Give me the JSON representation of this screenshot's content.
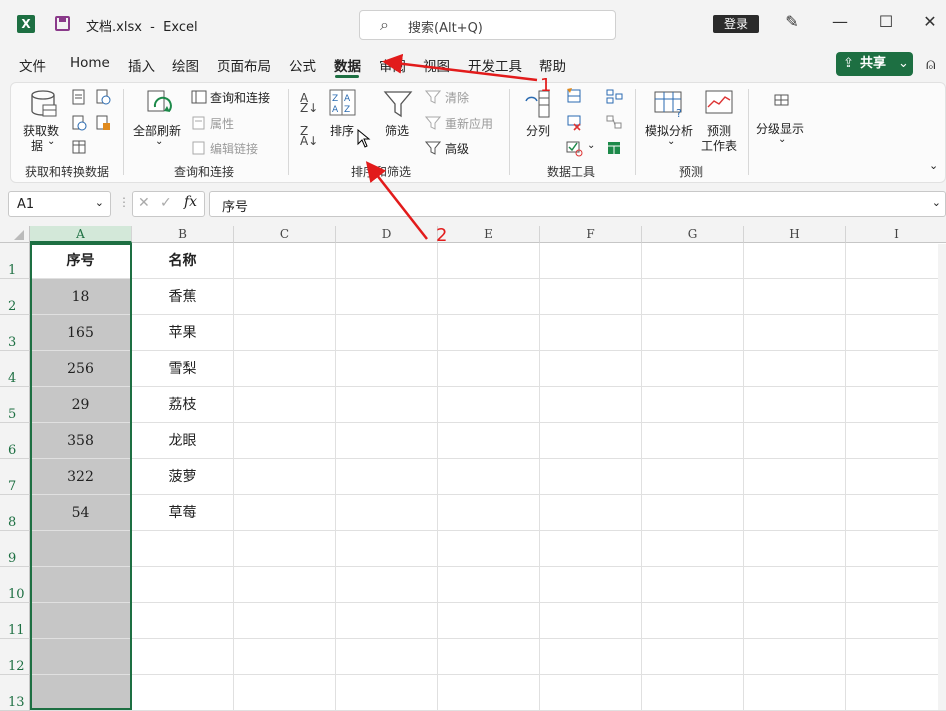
{
  "titlebar": {
    "filename": "文档.xlsx",
    "separator": "-",
    "app": "Excel",
    "search_placeholder": "搜索(Alt+Q)",
    "login": "登录"
  },
  "menu": {
    "tabs": [
      "文件",
      "Home",
      "插入",
      "绘图",
      "页面布局",
      "公式",
      "数据",
      "审阅",
      "视图",
      "开发工具",
      "帮助"
    ],
    "active": "数据",
    "share": "共享"
  },
  "ribbon": {
    "get_data": {
      "label_line1": "获取数",
      "label_line2": "据",
      "group": "获取和转换数据"
    },
    "queries": {
      "refresh_all": "全部刷新",
      "queries_connections": "查询和连接",
      "properties": "属性",
      "edit_links": "编辑链接",
      "group": "查询和连接"
    },
    "sort_filter": {
      "sort": "排序",
      "filter": "筛选",
      "clear": "清除",
      "reapply": "重新应用",
      "advanced": "高级",
      "group": "排序和筛选"
    },
    "data_tools": {
      "text_to_columns": "分列",
      "group": "数据工具"
    },
    "forecast": {
      "what_if": "模拟分析",
      "forecast_sheet_1": "预测",
      "forecast_sheet_2": "工作表",
      "group": "预测"
    },
    "outline": {
      "label": "分级显示"
    }
  },
  "formula_bar": {
    "name_box": "A1",
    "fx": "fx",
    "content": "序号"
  },
  "sheet": {
    "columns": [
      "A",
      "B",
      "C",
      "D",
      "E",
      "F",
      "G",
      "H",
      "I"
    ],
    "rows": [
      "1",
      "2",
      "3",
      "4",
      "5",
      "6",
      "7",
      "8",
      "9",
      "10",
      "11",
      "12",
      "13"
    ],
    "data": [
      [
        "序号",
        "名称"
      ],
      [
        "18",
        "香蕉"
      ],
      [
        "165",
        "苹果"
      ],
      [
        "256",
        "雪梨"
      ],
      [
        "29",
        "荔枝"
      ],
      [
        "358",
        "龙眼"
      ],
      [
        "322",
        "菠萝"
      ],
      [
        "54",
        "草莓"
      ]
    ]
  },
  "annotations": {
    "arrow1_label": "1",
    "arrow2_label": "2",
    "color": "#e21b1b"
  },
  "colors": {
    "accent": "#1d6f42",
    "selected_col": "#c6c6c6"
  }
}
